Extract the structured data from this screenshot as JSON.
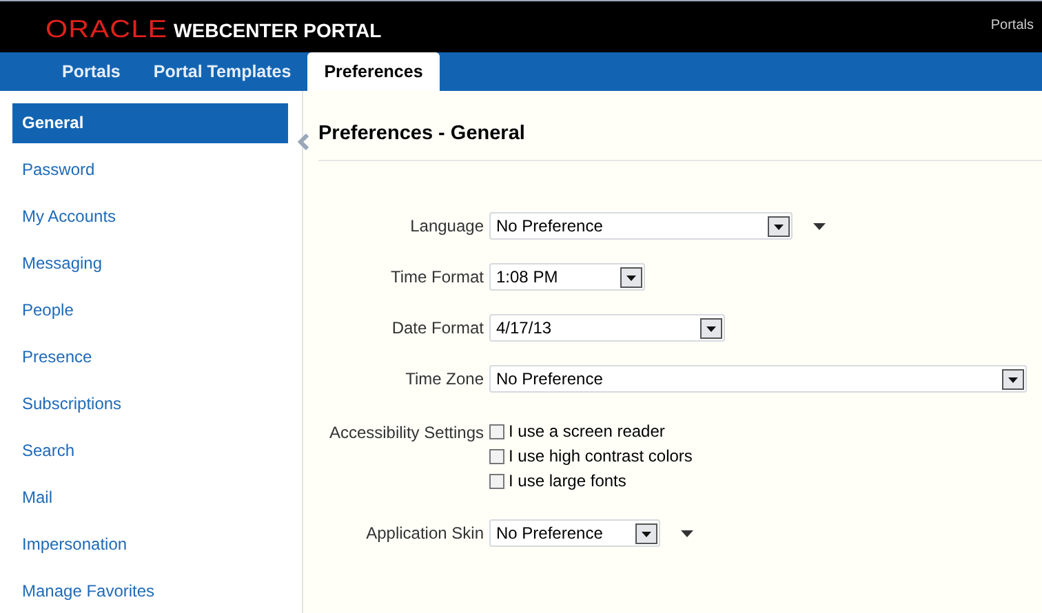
{
  "header": {
    "brand": "ORACLE",
    "product": "WEBCENTER PORTAL",
    "link": "Portals"
  },
  "tabs": [
    {
      "label": "Portals",
      "selected": false
    },
    {
      "label": "Portal Templates",
      "selected": false
    },
    {
      "label": "Preferences",
      "selected": true
    }
  ],
  "sidebar": {
    "items": [
      {
        "label": "General",
        "selected": true
      },
      {
        "label": "Password",
        "selected": false
      },
      {
        "label": "My Accounts",
        "selected": false
      },
      {
        "label": "Messaging",
        "selected": false
      },
      {
        "label": "People",
        "selected": false
      },
      {
        "label": "Presence",
        "selected": false
      },
      {
        "label": "Subscriptions",
        "selected": false
      },
      {
        "label": "Search",
        "selected": false
      },
      {
        "label": "Mail",
        "selected": false
      },
      {
        "label": "Impersonation",
        "selected": false
      },
      {
        "label": "Manage Favorites",
        "selected": false
      }
    ]
  },
  "page_title": "Preferences - General",
  "form": [
    {
      "kind": "select",
      "label": "Language",
      "value": "No Preference",
      "menu": true
    },
    {
      "kind": "select",
      "label": "Time Format",
      "value": "1:08 PM",
      "menu": false
    },
    {
      "kind": "select",
      "label": "Date Format",
      "value": "4/17/13",
      "menu": false
    },
    {
      "kind": "select",
      "label": "Time Zone",
      "value": "No Preference",
      "menu": false
    },
    {
      "kind": "checkboxes",
      "label": "Accessibility Settings",
      "options": [
        {
          "label": "I use a screen reader",
          "checked": false
        },
        {
          "label": "I use high contrast colors",
          "checked": false
        },
        {
          "label": "I use large fonts",
          "checked": false
        }
      ]
    },
    {
      "kind": "select",
      "label": "Application Skin",
      "value": "No Preference",
      "menu": true
    }
  ]
}
